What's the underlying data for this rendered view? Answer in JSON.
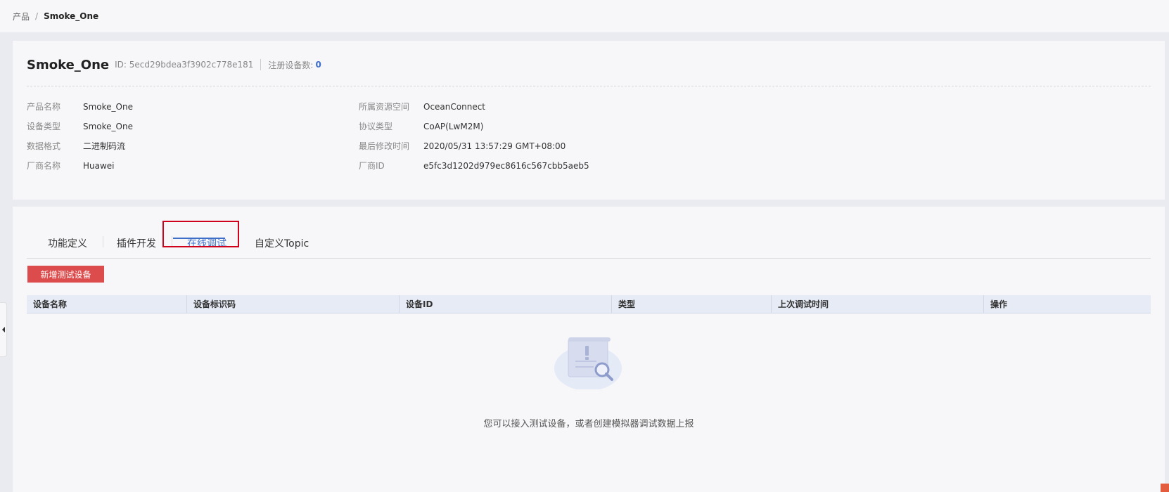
{
  "breadcrumb": {
    "parent": "产品",
    "separator": "/",
    "current": "Smoke_One"
  },
  "product": {
    "name": "Smoke_One",
    "id_text": "ID: 5ecd29bdea3f3902c778e181",
    "registered_label": "注册设备数:",
    "registered_count": "0"
  },
  "details": {
    "left": [
      {
        "label": "产品名称",
        "value": "Smoke_One"
      },
      {
        "label": "设备类型",
        "value": "Smoke_One"
      },
      {
        "label": "数据格式",
        "value": "二进制码流"
      },
      {
        "label": "厂商名称",
        "value": "Huawei"
      }
    ],
    "right": [
      {
        "label": "所属资源空间",
        "value": "OceanConnect"
      },
      {
        "label": "协议类型",
        "value": "CoAP(LwM2M)"
      },
      {
        "label": "最后修改时间",
        "value": "2020/05/31 13:57:29 GMT+08:00"
      },
      {
        "label": "厂商ID",
        "value": "e5fc3d1202d979ec8616c567cbb5aeb5"
      }
    ]
  },
  "tabs": [
    {
      "label": "功能定义"
    },
    {
      "label": "插件开发"
    },
    {
      "label": "在线调试"
    },
    {
      "label": "自定义Topic"
    }
  ],
  "active_tab": "在线调试",
  "add_button": "新增测试设备",
  "table": {
    "columns": [
      "设备名称",
      "设备标识码",
      "设备ID",
      "类型",
      "上次调试时间",
      "操作"
    ]
  },
  "empty_text": "您可以接入测试设备，或者创建模拟器调试数据上报",
  "colors": {
    "accent": "#3e6fc8",
    "button": "#dd4c4c",
    "highlight_box": "#d0021b"
  }
}
